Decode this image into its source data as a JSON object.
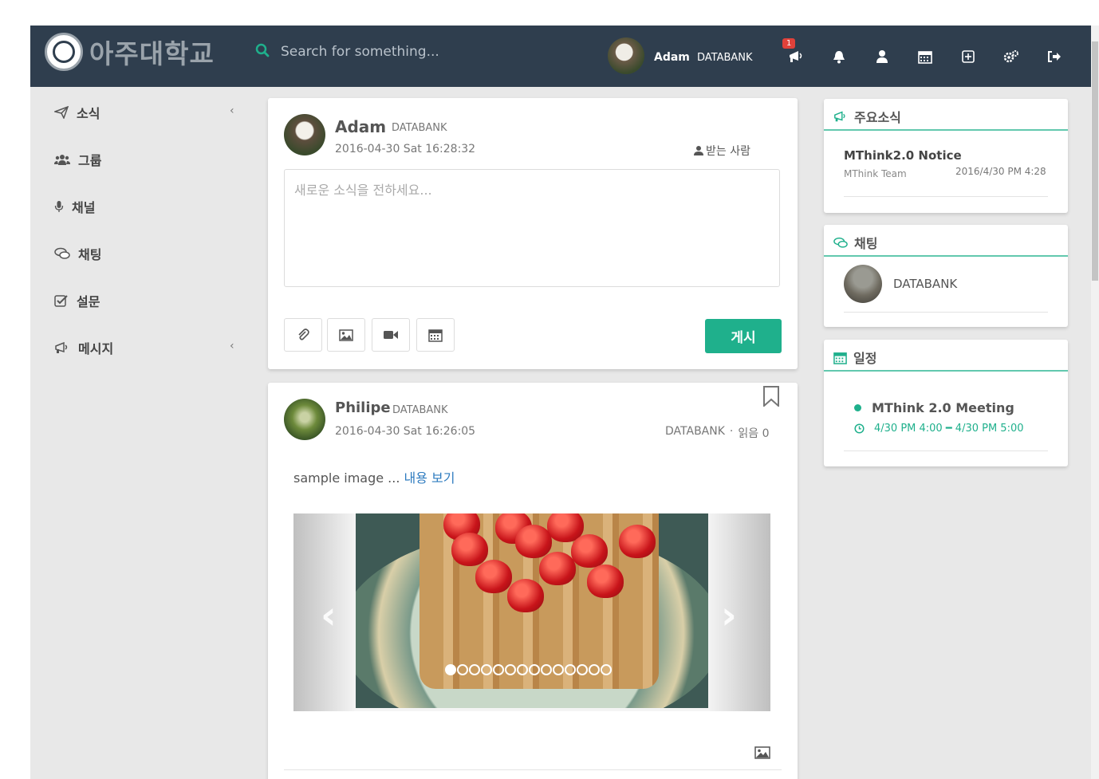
{
  "header": {
    "logo_text": "아주대학교",
    "search_placeholder": "Search for something...",
    "user": {
      "name": "Adam",
      "org": "DATABANK"
    },
    "icons": [
      {
        "name": "announcement-icon",
        "badge": "1"
      },
      {
        "name": "bell-icon"
      },
      {
        "name": "user-icon"
      },
      {
        "name": "calendar-icon"
      },
      {
        "name": "grid-plus-icon"
      },
      {
        "name": "settings-icon"
      },
      {
        "name": "logout-icon"
      }
    ]
  },
  "sidebar": {
    "items": [
      {
        "label": "소식",
        "icon": "paper-plane-icon",
        "has_chevron": true
      },
      {
        "label": "그룹",
        "icon": "users-icon",
        "has_chevron": false
      },
      {
        "label": "채널",
        "icon": "microphone-icon",
        "has_chevron": false
      },
      {
        "label": "채팅",
        "icon": "chat-icon",
        "has_chevron": false
      },
      {
        "label": "설문",
        "icon": "checkbox-icon",
        "has_chevron": false
      },
      {
        "label": "메시지",
        "icon": "megaphone-icon",
        "has_chevron": true
      }
    ],
    "chevron": "‹"
  },
  "composer": {
    "name": "Adam",
    "org": "DATABANK",
    "datetime": "2016-04-30 Sat 16:28:32",
    "recipients_label": "받는 사람",
    "placeholder": "새로운 소식을 전하세요...",
    "post_button": "게시"
  },
  "post": {
    "name": "Philipe",
    "org": "DATABANK",
    "datetime": "2016-04-30 Sat 16:26:05",
    "meta_org": "DATABANK",
    "meta_sep": "·",
    "read_label": "읽음 0",
    "text": "sample image ...",
    "more_link": "내용 보기",
    "carousel_dots": 14,
    "active_dot": 0
  },
  "right": {
    "news": {
      "title": "주요소식",
      "item_title": "MThink2.0 Notice",
      "item_author": "MThink Team",
      "item_date": "2016/4/30 PM 4:28"
    },
    "chat": {
      "title": "채팅",
      "item_name": "DATABANK"
    },
    "schedule": {
      "title": "일정",
      "event_title": "MThink 2.0 Meeting",
      "event_time": "4/30 PM 4:00 ━ 4/30 PM 5:00"
    }
  },
  "colors": {
    "topbar": "#2f3e4e",
    "accent": "#1fb08c",
    "badge": "#e0413a",
    "link": "#2e7bbf"
  }
}
